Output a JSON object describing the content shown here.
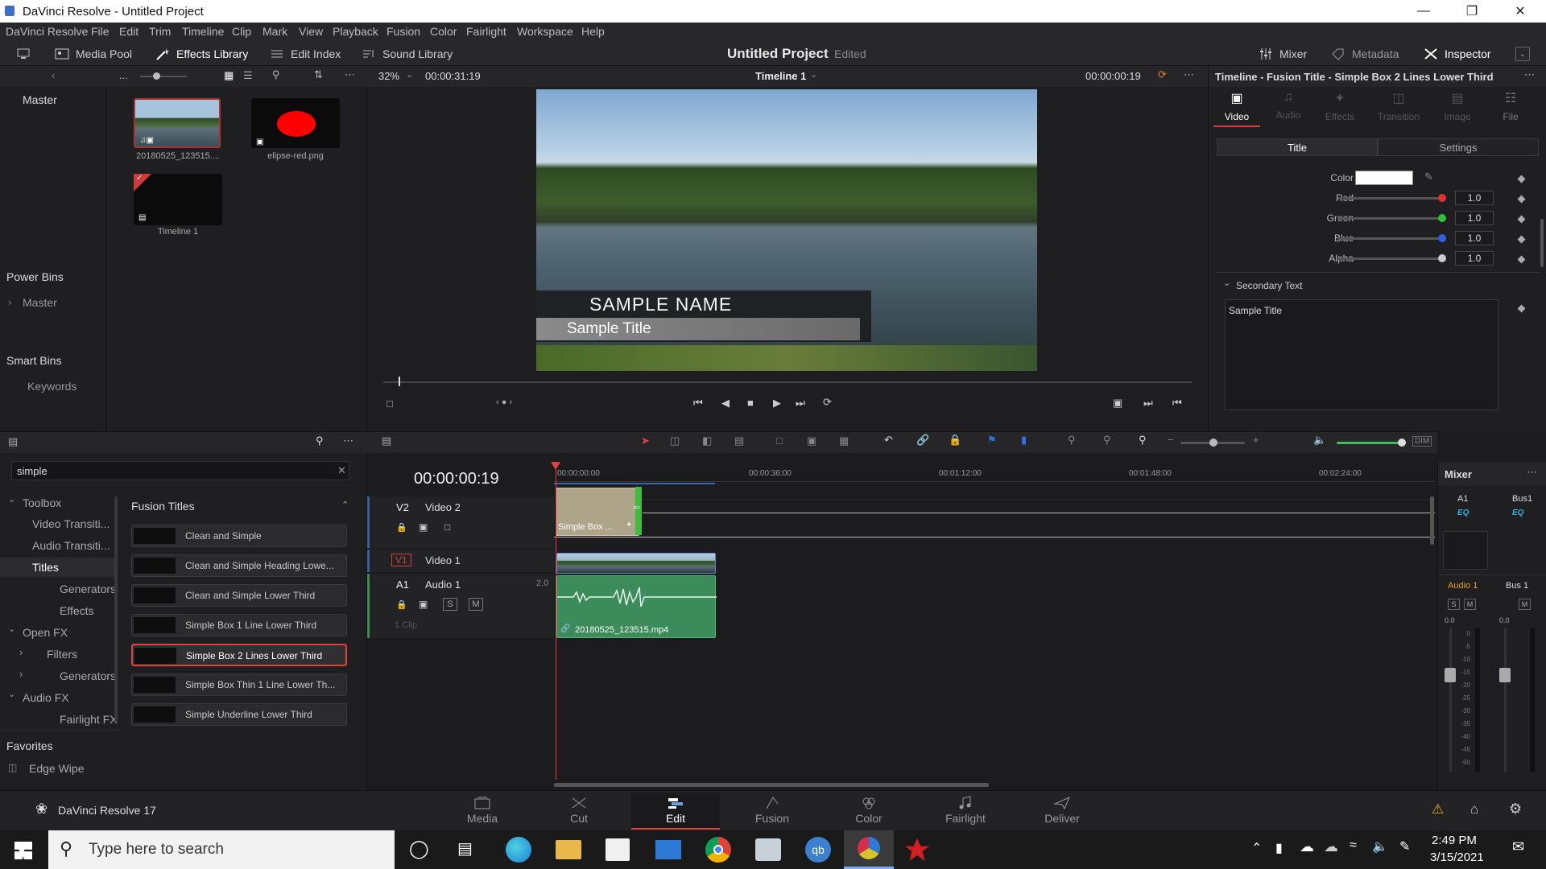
{
  "window": {
    "title": "DaVinci Resolve - Untitled Project"
  },
  "menu": [
    "DaVinci Resolve",
    "File",
    "Edit",
    "Trim",
    "Timeline",
    "Clip",
    "Mark",
    "View",
    "Playback",
    "Fusion",
    "Color",
    "Fairlight",
    "Workspace",
    "Help"
  ],
  "toolbar": {
    "media_pool": "Media Pool",
    "effects_library": "Effects Library",
    "edit_index": "Edit Index",
    "sound_library": "Sound Library",
    "project": "Untitled Project",
    "edited": "Edited",
    "mixer": "Mixer",
    "metadata": "Metadata",
    "inspector": "Inspector"
  },
  "viewer": {
    "zoom": "32%",
    "duration": "00:00:31:19",
    "timeline": "Timeline 1",
    "timecode": "00:00:00:19",
    "dots": "...",
    "name_text": "SAMPLE NAME",
    "title_text": "Sample Title"
  },
  "bins": {
    "master": "Master",
    "power_bins": "Power Bins",
    "power_master": "Master",
    "smart_bins": "Smart Bins",
    "keywords": "Keywords"
  },
  "media": [
    {
      "label": "20180525_123515...."
    },
    {
      "label": "elipse-red.png"
    },
    {
      "label": "Timeline 1"
    }
  ],
  "search": {
    "value": "simple"
  },
  "toolbox": {
    "items": [
      "Toolbox",
      "Video Transiti...",
      "Audio Transiti...",
      "Titles",
      "Generators",
      "Effects",
      "Open FX",
      "Filters",
      "Generators",
      "Audio FX",
      "Fairlight FX"
    ],
    "favorites": "Favorites",
    "fav_item": "Edge Wipe"
  },
  "fusion_titles": {
    "heading": "Fusion Titles",
    "items": [
      "Clean and Simple",
      "Clean and Simple Heading Lowe...",
      "Clean and Simple Lower Third",
      "Simple Box 1 Line Lower Third",
      "Simple Box 2 Lines Lower Third",
      "Simple Box Thin 1 Line Lower Th...",
      "Simple Underline Lower Third"
    ]
  },
  "timeline": {
    "timecode": "00:00:00:19",
    "ruler": [
      "00:00:00:00",
      "00:00:36:00",
      "00:01:12:00",
      "00:01:48:00",
      "00:02:24:00"
    ],
    "tracks": [
      {
        "id": "V2",
        "name": "Video 2"
      },
      {
        "id": "V1",
        "name": "Video 1"
      },
      {
        "id": "A1",
        "name": "Audio 1",
        "ch": "2.0",
        "clips": "1 Clip"
      }
    ],
    "title_clip": "Simple Box ...",
    "audio_clip": "20180525_123515.mp4"
  },
  "inspector": {
    "header": "Timeline - Fusion Title - Simple Box 2 Lines Lower Third",
    "tabs": [
      "Video",
      "Audio",
      "Effects",
      "Transition",
      "Image",
      "File"
    ],
    "subtabs": [
      "Title",
      "Settings"
    ],
    "color_label": "Color",
    "params": [
      {
        "label": "Red",
        "value": "1.0",
        "color": "#e03030"
      },
      {
        "label": "Green",
        "value": "1.0",
        "color": "#30c040"
      },
      {
        "label": "Blue",
        "value": "1.0",
        "color": "#3060e0"
      },
      {
        "label": "Alpha",
        "value": "1.0",
        "color": "#cccccc"
      }
    ],
    "secondary": "Secondary Text",
    "secondary_value": "Sample Title"
  },
  "mixer": {
    "title": "Mixer",
    "a1": "A1",
    "bus1": "Bus1",
    "eq": "EQ",
    "audio1": "Audio 1",
    "bus1b": "Bus 1",
    "s": "S",
    "m": "M",
    "val": "0.0",
    "scale": [
      "0",
      "-5",
      "-10",
      "-15",
      "-20",
      "-25",
      "-30",
      "-35",
      "-40",
      "-45",
      "-50"
    ]
  },
  "pages": [
    "Media",
    "Cut",
    "Edit",
    "Fusion",
    "Color",
    "Fairlight",
    "Deliver"
  ],
  "app_version": "DaVinci Resolve 17",
  "taskbar": {
    "search_placeholder": "Type here to search",
    "time": "2:49 PM",
    "date": "3/15/2021"
  }
}
